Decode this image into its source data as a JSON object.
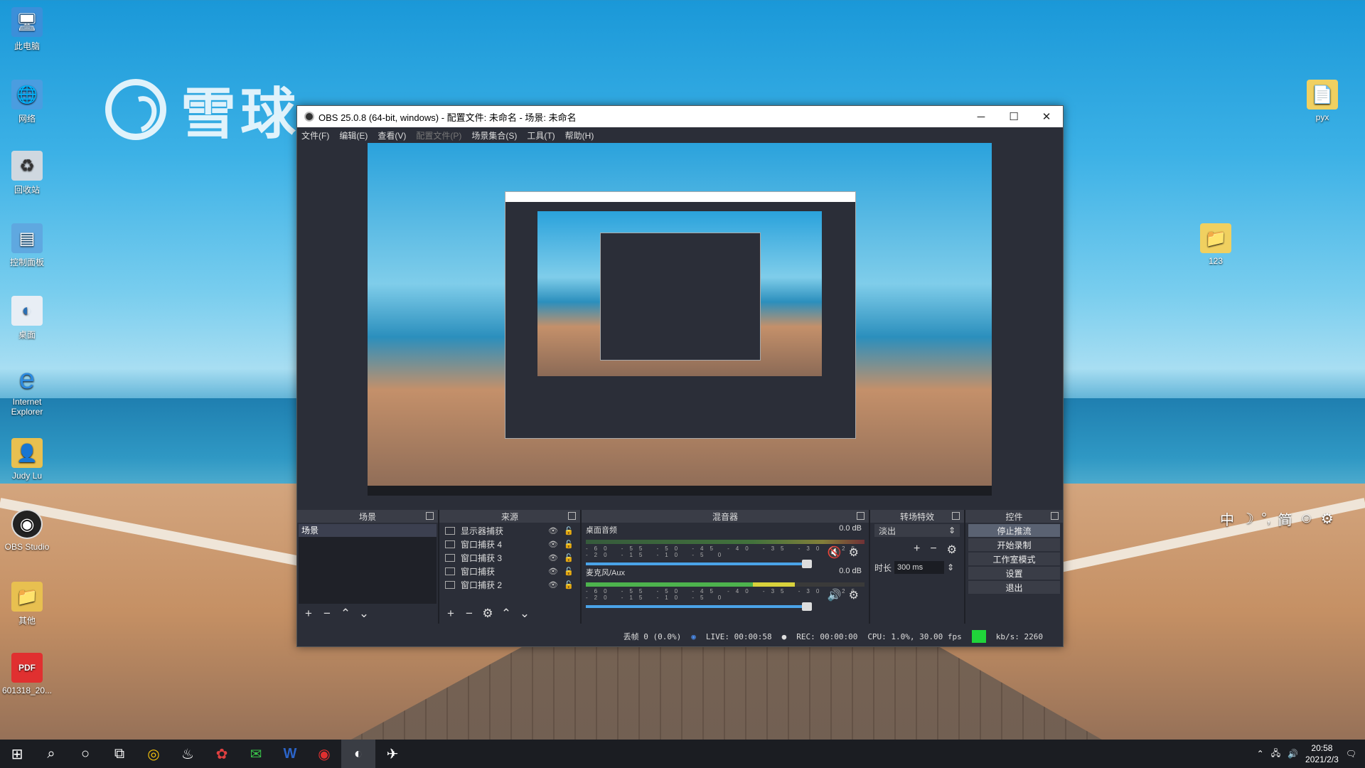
{
  "desktop": {
    "watermark_text": "雪球",
    "icons_left": [
      {
        "label": "此电脑",
        "icon": "computer-icon"
      },
      {
        "label": "网络",
        "icon": "network-icon"
      },
      {
        "label": "回收站",
        "icon": "recycle-bin-icon"
      },
      {
        "label": "控制面板",
        "icon": "control-panel-icon"
      },
      {
        "label": "桌面",
        "icon": "desktop-folder-icon"
      },
      {
        "label": "Internet Explorer",
        "icon": "ie-icon"
      },
      {
        "label": "Judy Lu",
        "icon": "user-folder-icon"
      },
      {
        "label": "OBS Studio",
        "icon": "obs-icon"
      },
      {
        "label": "其他",
        "icon": "folder-icon"
      },
      {
        "label": "601318_20...",
        "icon": "pdf-icon"
      }
    ],
    "icons_right": [
      {
        "label": "pyx",
        "icon": "file-icon"
      },
      {
        "label": "123",
        "icon": "folder-icon"
      }
    ]
  },
  "obs": {
    "title": "OBS 25.0.8 (64-bit, windows) - 配置文件: 未命名 - 场景: 未命名",
    "menu": [
      "文件(F)",
      "编辑(E)",
      "查看(V)",
      "配置文件(P)",
      "场景集合(S)",
      "工具(T)",
      "帮助(H)"
    ],
    "scenes": {
      "header": "场景",
      "items": [
        "场景"
      ]
    },
    "sources": {
      "header": "来源",
      "items": [
        "显示器捕获",
        "窗口捕获 4",
        "窗口捕获 3",
        "窗口捕获",
        "窗口捕获 2"
      ]
    },
    "mixer": {
      "header": "混音器",
      "channels": [
        {
          "name": "桌面音频",
          "db": "0.0 dB"
        },
        {
          "name": "麦克风/Aux",
          "db": "0.0 dB"
        }
      ],
      "ticks": "-60 -55 -50 -45 -40 -35 -30 -25 -20 -15 -10 -5 0"
    },
    "transitions": {
      "header": "转场特效",
      "selected": "淡出",
      "duration_label": "时长",
      "duration_value": "300 ms"
    },
    "controls": {
      "header": "控件",
      "buttons": [
        "停止推流",
        "开始录制",
        "工作室模式",
        "设置",
        "退出"
      ]
    },
    "status": {
      "dropped": "丢帧 0 (0.0%)",
      "live": "LIVE: 00:00:58",
      "rec": "REC: 00:00:00",
      "cpu": "CPU: 1.0%, 30.00 fps",
      "bitrate": "kb/s: 2260"
    }
  },
  "ime": [
    "中",
    "☽",
    "°,",
    "简",
    "☺",
    "⚙"
  ],
  "taskbar": {
    "time": "20:58",
    "date": "2021/2/3"
  }
}
